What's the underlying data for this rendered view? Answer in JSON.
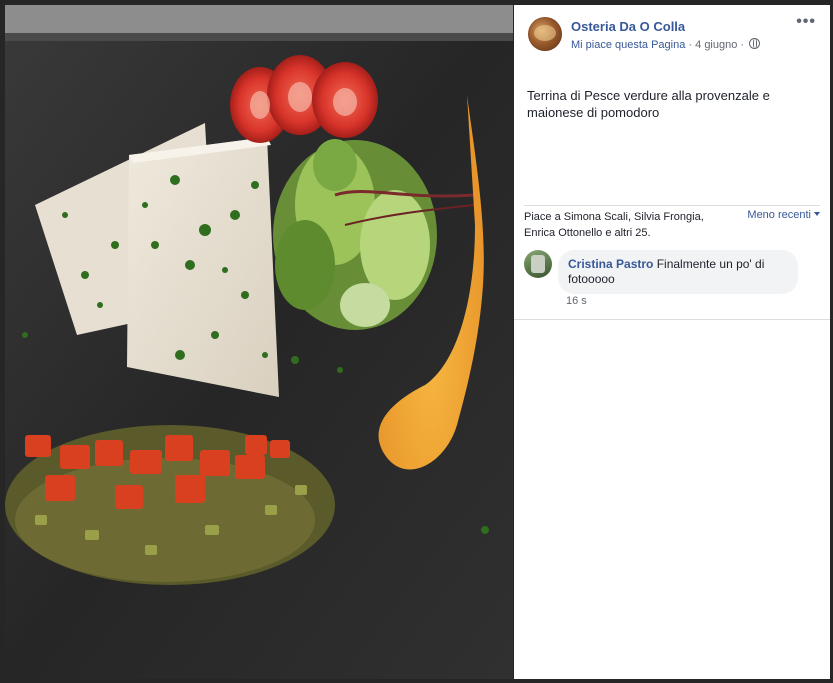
{
  "post": {
    "page_name": "Osteria Da O Colla",
    "like_page": "Mi piace questa Pagina",
    "separator": " · ",
    "date": "4 giugno",
    "caption": "Terrina di Pesce verdure alla provenzale e maionese di pomodoro",
    "more_icon": "more-horizontal-icon",
    "privacy_icon": "globe-icon"
  },
  "reactions": {
    "summary": "Piace a Simona Scali, Silvia Frongia, Enrica Ottonello e altri 25.",
    "sort": "Meno recenti"
  },
  "comments": [
    {
      "author": "Cristina Pastro",
      "text": "Finalmente un po' di fotooooo",
      "time": "16 s"
    }
  ],
  "colors": {
    "link": "#385898",
    "secondary_text": "#616770",
    "bubble": "#f2f3f5"
  }
}
